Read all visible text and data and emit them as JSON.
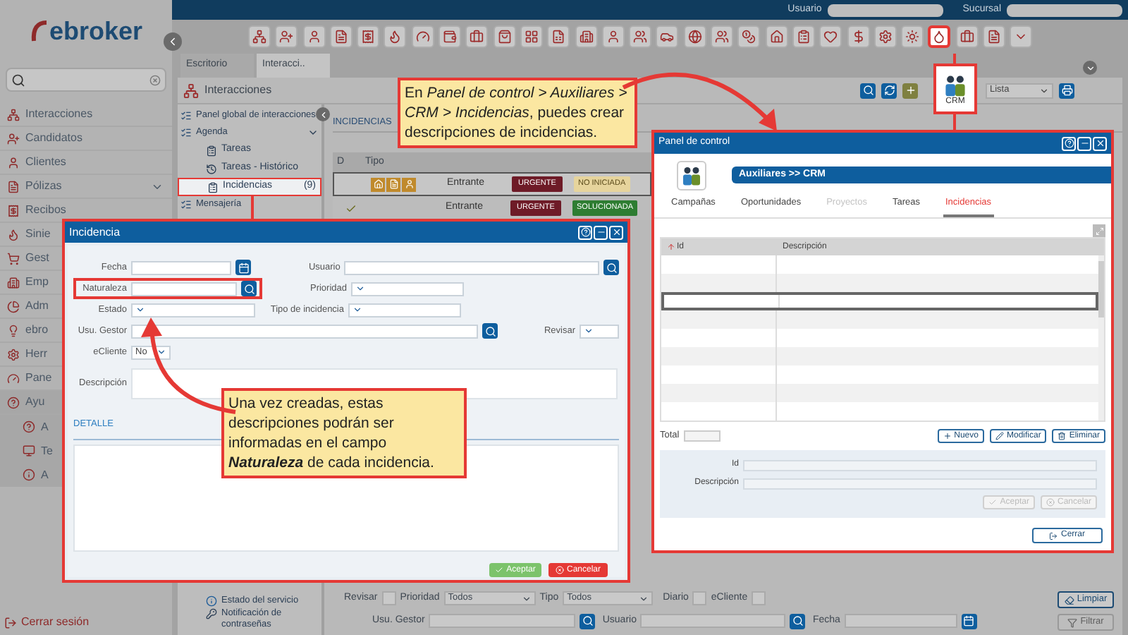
{
  "logo": "ebroker",
  "sidebar": {
    "items": [
      {
        "label": "Interacciones",
        "expandable": false
      },
      {
        "label": "Candidatos",
        "expandable": false
      },
      {
        "label": "Clientes",
        "expandable": false
      },
      {
        "label": "Pólizas",
        "expandable": true
      },
      {
        "label": "Recibos",
        "expandable": false
      },
      {
        "label": "Sinie",
        "expandable": false
      },
      {
        "label": "Gest",
        "expandable": false
      },
      {
        "label": "Emp",
        "expandable": false
      },
      {
        "label": "Adm",
        "expandable": false
      },
      {
        "label": "ebro",
        "expandable": false
      },
      {
        "label": "Herr",
        "expandable": false
      },
      {
        "label": "Pane",
        "expandable": false
      },
      {
        "label": "Ayu",
        "expandable": false,
        "children": [
          {
            "label": "A"
          },
          {
            "label": "Te"
          },
          {
            "label": "A"
          }
        ]
      }
    ],
    "logout": "Cerrar sesión"
  },
  "topbar": {
    "user_label": "Usuario",
    "branch_label": "Sucursal"
  },
  "tabs": [
    {
      "label": "Escritorio",
      "selected": false
    },
    {
      "label": "Interacci..",
      "selected": true
    }
  ],
  "module": {
    "title": "Interacciones",
    "view": "Lista",
    "tree": [
      {
        "label": "Panel global de interacciones"
      },
      {
        "label": "Agenda",
        "expanded": true,
        "children": [
          {
            "label": "Tareas",
            "selected": false
          },
          {
            "label": "Tareas - Histórico",
            "selected": false
          },
          {
            "label": "Incidencias",
            "count": "(9)",
            "selected": true
          }
        ]
      },
      {
        "label": "Mensajería"
      }
    ],
    "tree_bottom": [
      {
        "label": "Estado del servicio"
      },
      {
        "label": "Notificación de contraseñas"
      }
    ]
  },
  "list": {
    "title": "INCIDENCIAS",
    "columns": [
      "D",
      "Tipo"
    ],
    "rows": [
      {
        "selected": true,
        "checked": false,
        "direction": "Entrante",
        "priority": "URGENTE",
        "status": "NO INICIADA",
        "color": "#e6d49c"
      },
      {
        "selected": false,
        "checked": true,
        "direction": "Entrante",
        "priority": "URGENTE",
        "status": "SOLUCIONADA",
        "color": "#2e7d32"
      }
    ]
  },
  "filters": {
    "review": {
      "label": "Revisar",
      "checked": false
    },
    "priority_label": "Prioridad",
    "priority_value": "Todos",
    "type_label": "Tipo",
    "type_value": "Todos",
    "daily": {
      "label": "Diario",
      "checked": false
    },
    "ecliente": {
      "label": "eCliente",
      "checked": false
    },
    "manager": "Usu. Gestor",
    "user": "Usuario",
    "date": "Fecha",
    "clear": "Limpiar",
    "filter": {
      "label": "Filtrar",
      "disabled": true
    }
  },
  "crm_shortcut": "CRM",
  "callouts": [
    {
      "text": "En *Panel de control > Auxiliares > CRM > Incidencias*, puedes crear descripciones de incidencias."
    },
    {
      "text": "Una vez creadas, estas descripciones podrán ser informadas en el campo **Naturaleza** de cada incidencia."
    }
  ],
  "control_panel": {
    "title": "Panel de control",
    "breadcrumb": "Auxiliares >> CRM",
    "tabs": [
      {
        "label": "Campañas",
        "selected": false,
        "disabled": false
      },
      {
        "label": "Oportunidades",
        "selected": false,
        "disabled": false
      },
      {
        "label": "Proyectos",
        "selected": false,
        "disabled": true
      },
      {
        "label": "Tareas",
        "selected": false,
        "disabled": false
      },
      {
        "label": "Incidencias",
        "selected": true,
        "disabled": false
      }
    ],
    "columns": [
      "Id",
      "Descripción"
    ],
    "rows": [
      {
        "selected": false
      },
      {
        "selected": false
      },
      {
        "selected": true
      },
      {
        "selected": false
      },
      {
        "selected": false
      },
      {
        "selected": false
      },
      {
        "selected": false
      },
      {
        "selected": false
      },
      {
        "selected": false
      }
    ],
    "total_label": "Total",
    "actions": [
      "Nuevo",
      "Modificar",
      "Eliminar"
    ],
    "form": {
      "fields": [
        "Id",
        "Descripción"
      ],
      "accept": {
        "label": "Aceptar",
        "disabled": true
      },
      "cancel": {
        "label": "Cancelar",
        "disabled": true
      }
    },
    "close": "Cerrar"
  },
  "incident": {
    "title": "Incidencia",
    "date": "Fecha",
    "user": "Usuario",
    "nature": "Naturaleza",
    "priority": "Prioridad",
    "state": "Estado",
    "type": "Tipo de incidencia",
    "manager": "Usu. Gestor",
    "review": "Revisar",
    "ecliente": {
      "label": "eCliente",
      "value": "No"
    },
    "description": "Descripción",
    "detail": "DETALLE",
    "accept": "Aceptar",
    "cancel": "Cancelar"
  }
}
